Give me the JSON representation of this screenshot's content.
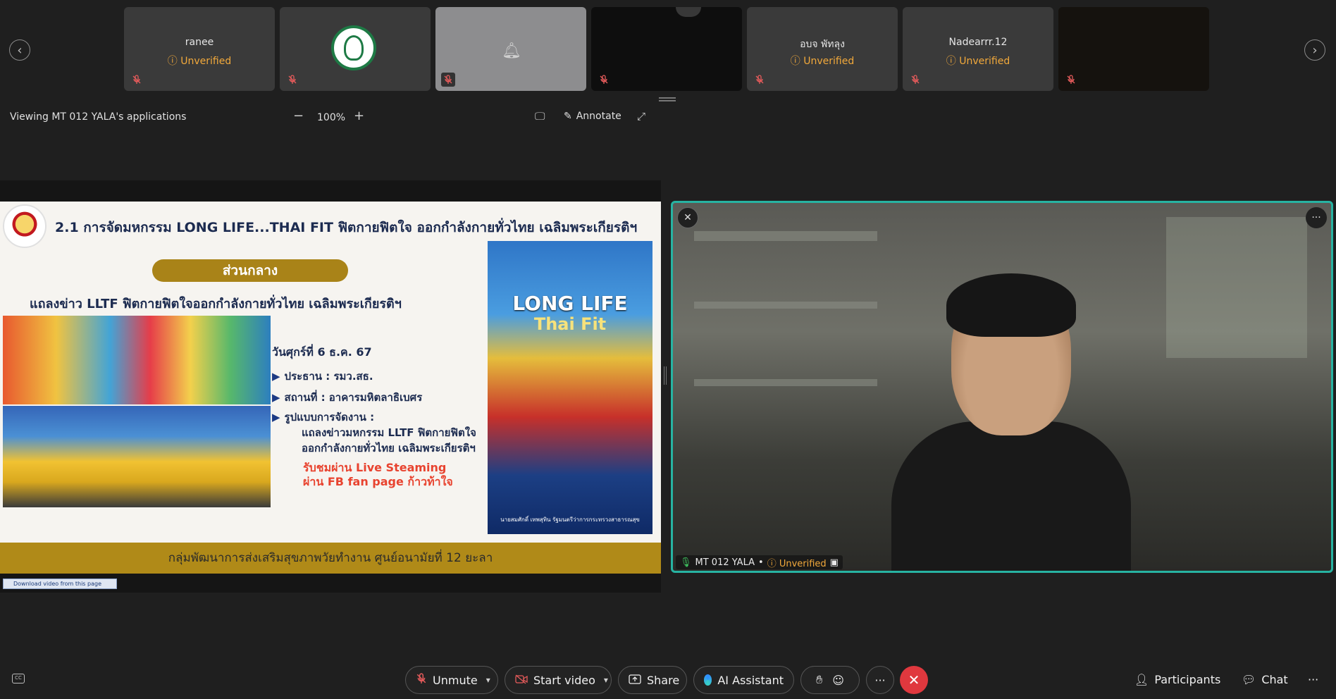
{
  "strip": {
    "prev_icon": "chevron-left-icon",
    "next_icon": "chevron-right-icon",
    "tiles": [
      {
        "name": "ranee",
        "status": "Unverified"
      },
      {
        "name": "",
        "status": "",
        "avatar": "ministry-logo"
      },
      {
        "name": "",
        "status": "",
        "avatar": "bell-icon"
      },
      {
        "name": "",
        "status": ""
      },
      {
        "name": "อบจ พัทลุง",
        "status": "Unverified"
      },
      {
        "name": "Nadearrr.12",
        "status": "Unverified"
      },
      {
        "name": "",
        "status": ""
      }
    ]
  },
  "toolbar": {
    "viewing_text": "Viewing MT 012 YALA's applications",
    "zoom_minus": "−",
    "zoom_value": "100%",
    "zoom_plus": "+",
    "annotate_label": "Annotate"
  },
  "slide": {
    "title": "2.1 การจัดมหกรรม LONG LIFE...THAI FIT ฟิตกายฟิตใจ ออกกำลังกายทั่วไทย เฉลิมพระเกียรติฯ",
    "section_pill": "ส่วนกลาง",
    "subtitle": "แถลงข่าว LLTF ฟิตกายฟิตใจออกกำลังกายทั่วไทย เฉลิมพระเกียรติฯ",
    "date": "วันศุกร์ที่ 6 ธ.ค. 67",
    "chair": "ประธาน : รมว.สธ.",
    "venue": "สถานที่ : อาคารมหิตลาธิเบศร",
    "format_label": "รูปแบบการจัดงาน :",
    "format_line1": "แถลงข่าวมหกรรม LLTF ฟิตกายฟิตใจ",
    "format_line2": "ออกกำลังกายทั่วไทย เฉลิมพระเกียรติฯ",
    "live_line1": "รับชมผ่าน Live Steaming",
    "live_line2": "ผ่าน FB fan page ก้าวท้าใจ",
    "poster_title": "LONG LIFE",
    "poster_sub": "Thai Fit",
    "poster_caption": "นายสมศักดิ์ เทพสุทิน รัฐมนตรีว่าการกระทรวงสาธารณสุข",
    "footer": "กลุ่มพัฒนาการส่งเสริมสุขภาพวัยทำงาน ศูนย์อนามัยที่ 12 ยะลา"
  },
  "download_bar": "Download video from this page",
  "speaker": {
    "name": "MT 012 YALA",
    "status": "Unverified"
  },
  "controls": {
    "unmute": "Unmute",
    "start_video": "Start video",
    "share": "Share",
    "ai_assistant": "AI Assistant",
    "more": "···",
    "participants": "Participants",
    "chat": "Chat",
    "overflow": "···"
  },
  "colors": {
    "accent_teal": "#27b3a2",
    "unverified_orange": "#f2a93b",
    "end_call_red": "#e0383e",
    "slide_gold": "#b08a18"
  }
}
